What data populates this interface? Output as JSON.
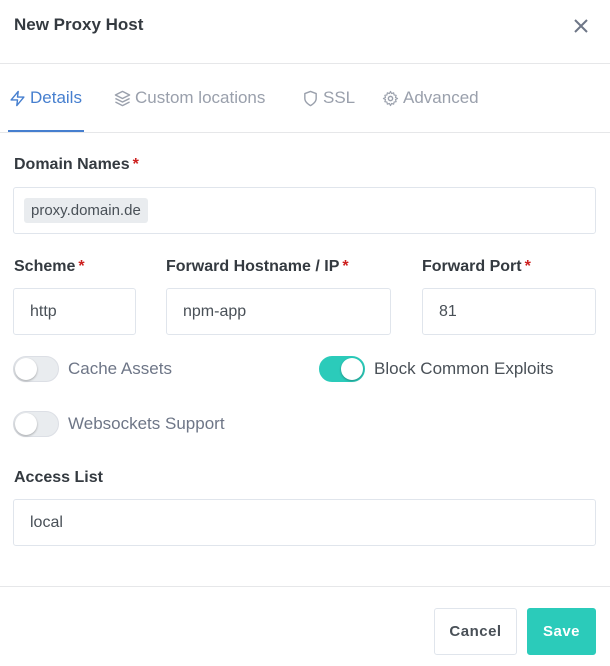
{
  "modal": {
    "title": "New Proxy Host",
    "close_icon": "close-icon"
  },
  "tabs": [
    {
      "label": "Details",
      "icon": "lightning-icon",
      "active": true
    },
    {
      "label": "Custom locations",
      "icon": "layers-icon",
      "active": false
    },
    {
      "label": "SSL",
      "icon": "shield-icon",
      "active": false
    },
    {
      "label": "Advanced",
      "icon": "gear-icon",
      "active": false
    }
  ],
  "form": {
    "domain_names": {
      "label": "Domain Names",
      "required_mark": "*",
      "chips": [
        "proxy.domain.de"
      ]
    },
    "scheme": {
      "label": "Scheme",
      "required_mark": "*",
      "value": "http"
    },
    "forward_hostname": {
      "label": "Forward Hostname / IP",
      "required_mark": "*",
      "value": "npm-app"
    },
    "forward_port": {
      "label": "Forward Port",
      "required_mark": "*",
      "value": "81"
    },
    "toggles": [
      {
        "label": "Cache Assets",
        "on": false
      },
      {
        "label": "Block Common Exploits",
        "on": true
      },
      {
        "label": "Websockets Support",
        "on": false
      }
    ],
    "access_list": {
      "label": "Access List",
      "value": "local"
    }
  },
  "footer": {
    "cancel_label": "Cancel",
    "save_label": "Save"
  },
  "colors": {
    "accent": "#467fcf",
    "success": "#2bcbba",
    "required": "#cd201f"
  }
}
